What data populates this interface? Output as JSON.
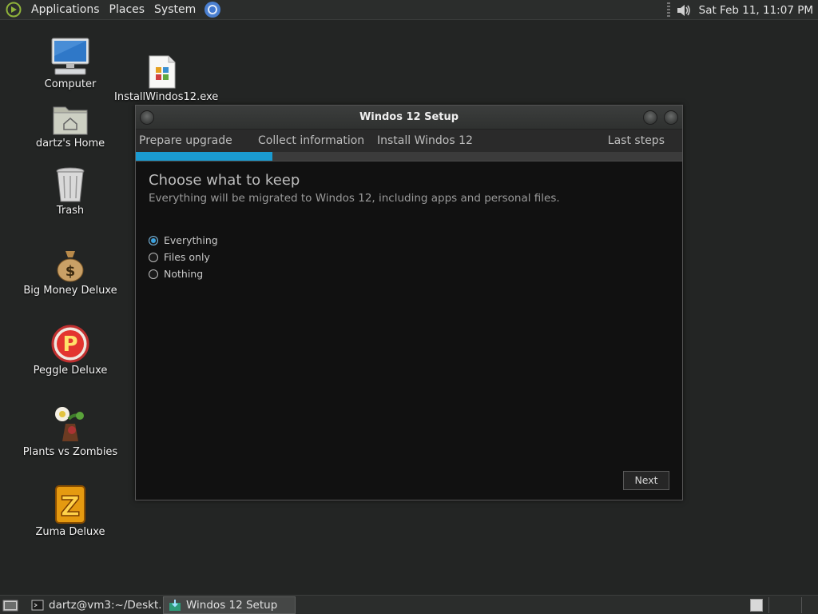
{
  "top_panel": {
    "menus": [
      "Applications",
      "Places",
      "System"
    ],
    "clock": "Sat Feb 11, 11:07 PM",
    "icons": [
      "distro-menu-icon",
      "chromium-icon",
      "volume-icon"
    ]
  },
  "desktop": {
    "icons": [
      {
        "label": "Computer",
        "icon": "computer-icon"
      },
      {
        "label": "dartz's Home",
        "icon": "home-folder-icon"
      },
      {
        "label": "Trash",
        "icon": "trash-icon"
      },
      {
        "label": "Big Money Deluxe",
        "icon": "money-bag-icon"
      },
      {
        "label": "Peggle Deluxe",
        "icon": "peggle-icon"
      },
      {
        "label": "Plants vs Zombies",
        "icon": "plants-vs-zombies-icon"
      },
      {
        "label": "Zuma Deluxe",
        "icon": "zuma-icon"
      },
      {
        "label": "InstallWindos12.exe",
        "icon": "exe-file-icon"
      }
    ]
  },
  "window": {
    "title": "Windos 12 Setup",
    "steps": [
      "Prepare upgrade",
      "Collect information",
      "Install Windos 12",
      "Last steps"
    ],
    "progress": 0.25,
    "accent": "#1a9bd1",
    "heading": "Choose what to keep",
    "subheading": "Everything will be migrated to Windos 12, including apps and personal files.",
    "options": [
      {
        "label": "Everything",
        "selected": true
      },
      {
        "label": "Files only",
        "selected": false
      },
      {
        "label": "Nothing",
        "selected": false
      }
    ],
    "next_label": "Next"
  },
  "taskbar": {
    "tasks": [
      {
        "label": "dartz@vm3:~/Deskt...",
        "icon": "terminal-icon",
        "active": false
      },
      {
        "label": "Windos 12 Setup",
        "icon": "setup-icon",
        "active": true
      }
    ]
  }
}
